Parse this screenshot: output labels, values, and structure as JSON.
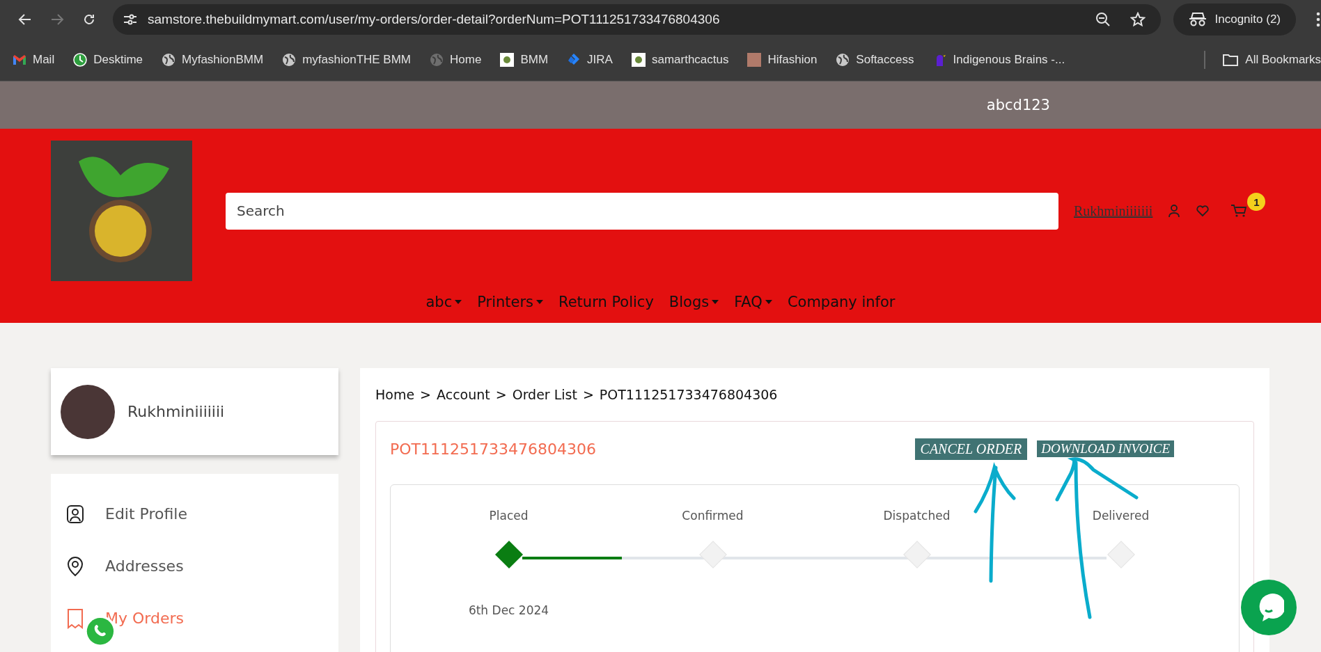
{
  "browser": {
    "back_disabled": false,
    "forward_disabled": true,
    "url": "samstore.thebuildmymart.com/user/my-orders/order-detail?orderNum=POT111251733476804306",
    "profile": "Incognito (2)",
    "bookmarks": [
      {
        "label": "Mail",
        "kind": "mail"
      },
      {
        "label": "Desktime",
        "kind": "clock"
      },
      {
        "label": "MyfashionBMM",
        "kind": "globe"
      },
      {
        "label": "myfashionTHE BMM",
        "kind": "globe"
      },
      {
        "label": "Home",
        "kind": "globe-dim"
      },
      {
        "label": "BMM",
        "kind": "square"
      },
      {
        "label": "JIRA",
        "kind": "jira"
      },
      {
        "label": "samarthcactus",
        "kind": "square"
      },
      {
        "label": "Hifashion",
        "kind": "photo"
      },
      {
        "label": "Softaccess",
        "kind": "globe"
      },
      {
        "label": "Indigenous Brains -...",
        "kind": "figure"
      }
    ],
    "all_bookmarks": "All Bookmarks"
  },
  "top_bar": {
    "text": "abcd123"
  },
  "header": {
    "search": {
      "placeholder": "Search"
    },
    "user_name": "Rukhminiiiiiii",
    "cart_count": "1",
    "nav": [
      {
        "label": "abc",
        "dropdown": true
      },
      {
        "label": "Printers",
        "dropdown": true
      },
      {
        "label": "Return Policy",
        "dropdown": false
      },
      {
        "label": "Blogs",
        "dropdown": true
      },
      {
        "label": "FAQ",
        "dropdown": true
      },
      {
        "label": "Company infor",
        "dropdown": false
      }
    ]
  },
  "sidebar": {
    "user_name": "Rukhminiiiiiii",
    "items": [
      {
        "label": "Edit Profile",
        "kind": "profile",
        "selected": false
      },
      {
        "label": "Addresses",
        "kind": "pin",
        "selected": false
      },
      {
        "label": "My Orders",
        "kind": "receipt",
        "selected": true
      }
    ]
  },
  "order": {
    "breadcrumb": [
      {
        "label": "Home"
      },
      {
        "separator": ">",
        "label": "Account"
      },
      {
        "separator": ">",
        "label": "Order List"
      },
      {
        "separator": ">",
        "label": "POT111251733476804306"
      }
    ],
    "number": "POT111251733476804306",
    "buttons": [
      "CANCEL ORDER",
      "DOWNLOAD INVOICE"
    ],
    "progress": {
      "level": 0.17
    },
    "steps": [
      {
        "label": "Placed",
        "done": true,
        "date": "6th Dec 2024"
      },
      {
        "label": "Confirmed",
        "done": false
      },
      {
        "label": "Dispatched",
        "done": false
      },
      {
        "label": "Delivered",
        "done": false
      }
    ]
  }
}
